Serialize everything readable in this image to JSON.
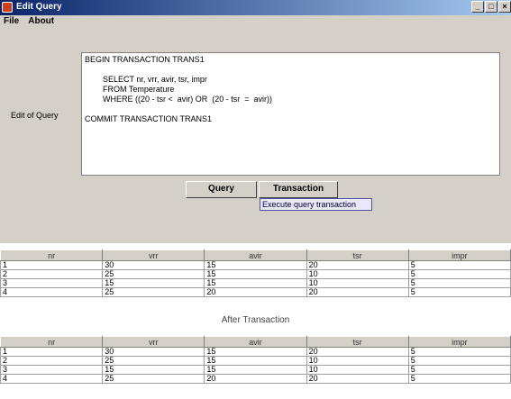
{
  "window": {
    "title": "Edit Query",
    "minimize": "_",
    "maximize": "□",
    "close": "×"
  },
  "menu": [
    "File",
    "About"
  ],
  "editor": {
    "label": "Edit of Query",
    "lines": [
      "BEGIN TRANSACTION TRANS1",
      "",
      "SELECT nr, vrr, avir, tsr, impr",
      "FROM Temperature",
      "WHERE ((20 - tsr <  avir) OR  (20 - tsr  =  avir))",
      "",
      "COMMIT TRANSACTION TRANS1"
    ]
  },
  "buttons": {
    "query": "Query",
    "transaction": "Transaction"
  },
  "tooltip": "Execute query transaction",
  "table_before": {
    "columns": [
      "nr",
      "vrr",
      "avir",
      "tsr",
      "impr"
    ],
    "rows": [
      [
        "1",
        "30",
        "15",
        "20",
        "5"
      ],
      [
        "2",
        "25",
        "15",
        "10",
        "5"
      ],
      [
        "3",
        "15",
        "15",
        "10",
        "5"
      ],
      [
        "4",
        "25",
        "20",
        "20",
        "5"
      ]
    ]
  },
  "caption": "After Transaction",
  "table_after": {
    "columns": [
      "nr",
      "vrr",
      "avir",
      "tsr",
      "impr"
    ],
    "rows": [
      [
        "1",
        "30",
        "15",
        "20",
        "5"
      ],
      [
        "2",
        "25",
        "15",
        "10",
        "5"
      ],
      [
        "3",
        "15",
        "15",
        "10",
        "5"
      ],
      [
        "4",
        "25",
        "20",
        "20",
        "5"
      ]
    ]
  }
}
